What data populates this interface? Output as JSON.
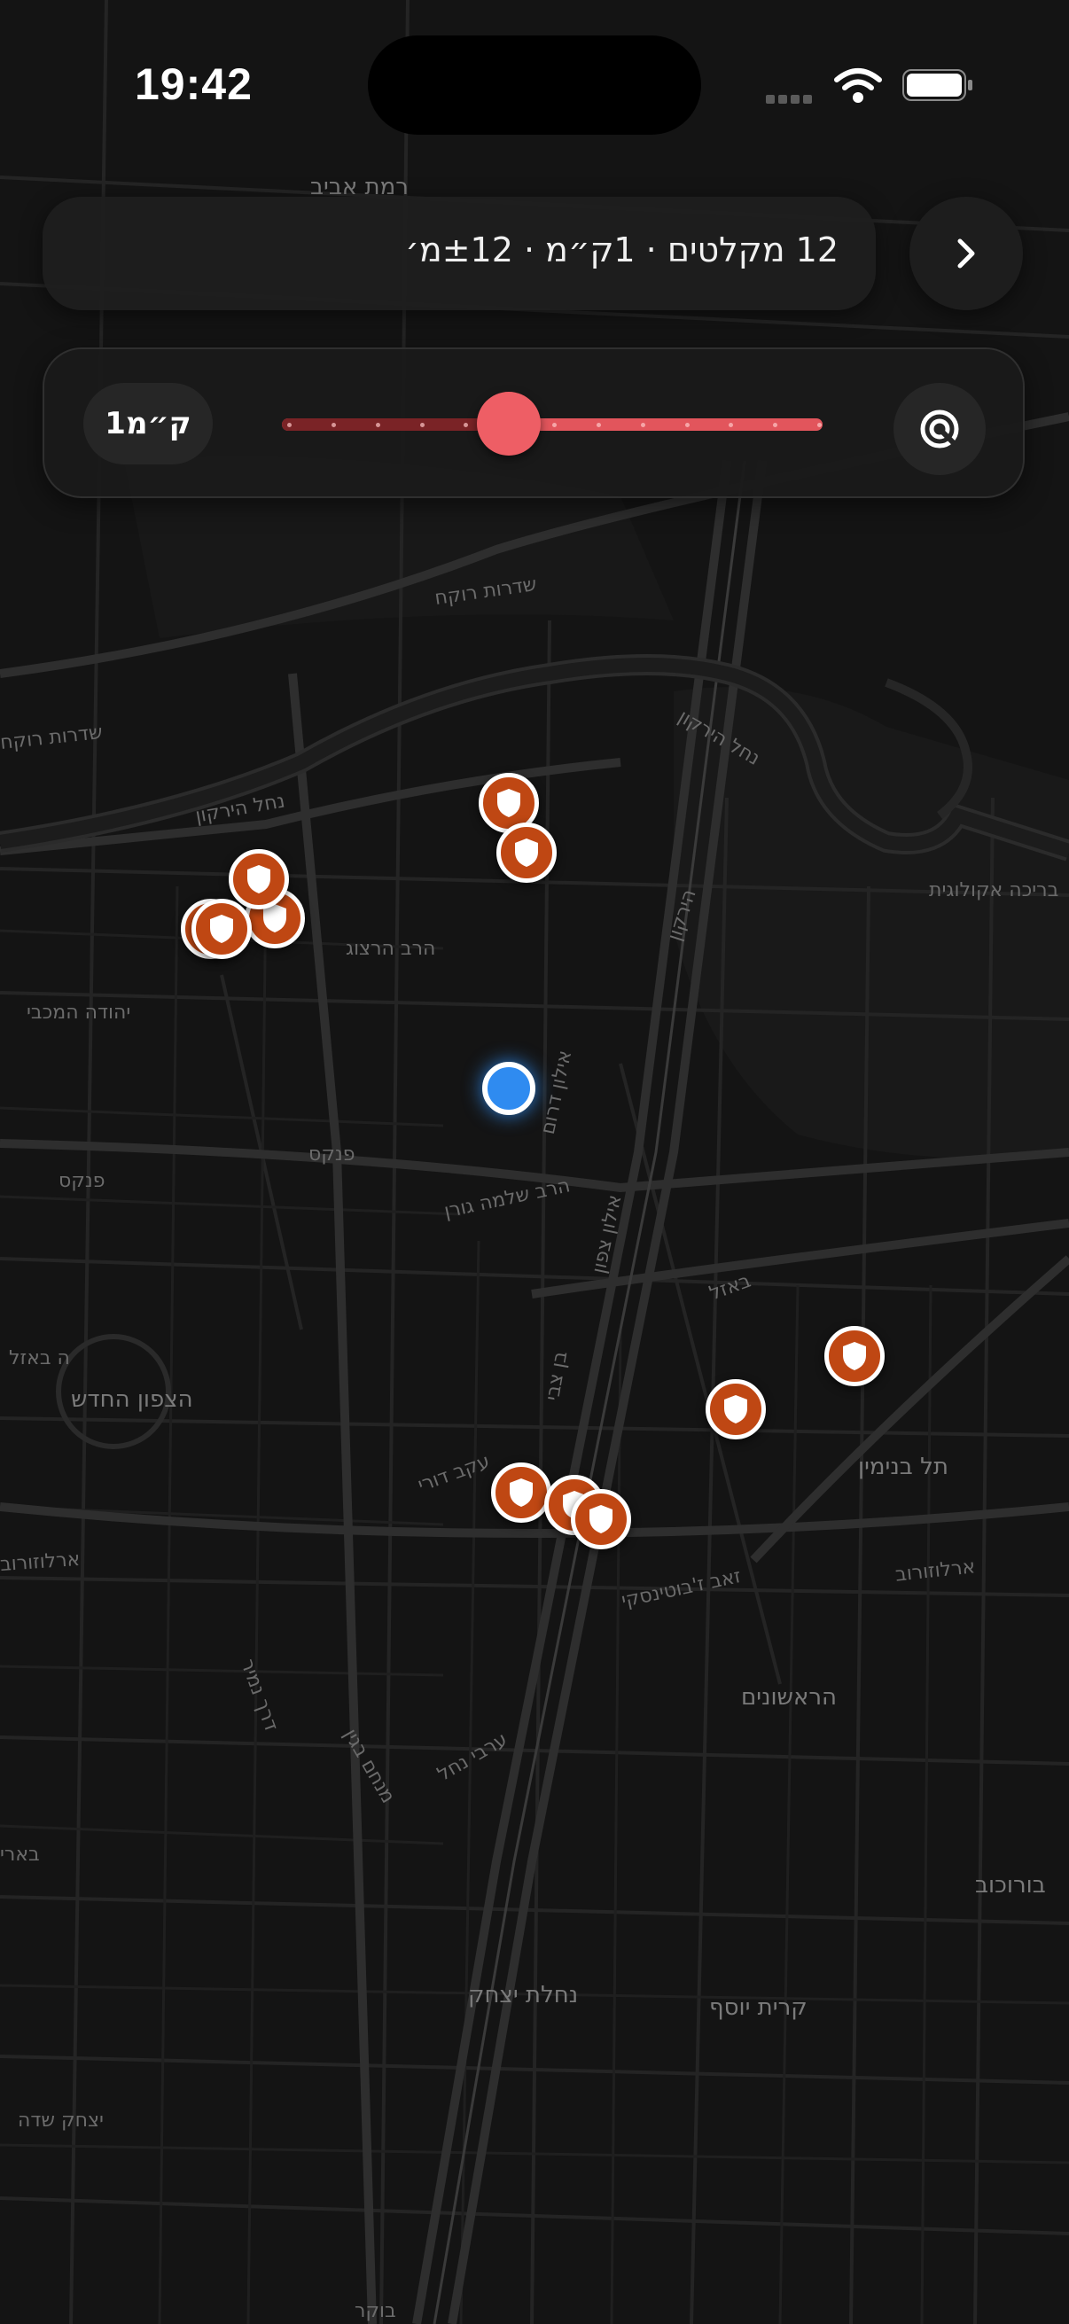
{
  "status_bar": {
    "time": "19:42"
  },
  "info_bar": {
    "summary": "12 מקלטים · 1ק״מ · ±12מ׳",
    "chevron_icon": "chevron-right-icon"
  },
  "radius_control": {
    "value_label": "1ק״מ",
    "slider_fraction": 0.42,
    "target_icon": "target-icon"
  },
  "map_labels": [
    "רמת אביב",
    "שדרות רוקח",
    "שדרות רוקח",
    "נחל הירקון",
    "נחל הירקון",
    "בריכה אקולוגית",
    "יהודה המכבי",
    "פנקס",
    "פנקס",
    "הרב הרצוג",
    "הרב שלמה גורן",
    "באזל",
    "ה באזל",
    "הצפון החדש",
    "אילון צפון",
    "אילון דרום",
    "ארלוזורוב",
    "ארלוזורוב",
    "תל בנימין",
    "זאב ז'בוטינסקי",
    "הראשונים",
    "בורוכוב",
    "נחלת יצחק",
    "קרית יוסף",
    "עקב דורי",
    "דרך נמיר",
    "מנחם בגין",
    "ערבי נחל",
    "בן צבי",
    "הירקון",
    "בארי",
    "יצחק שדה",
    "בוקר"
  ],
  "colors": {
    "marker_fill": "#bf4713",
    "accent_slider": "#ee5e65",
    "user_dot": "#2f8bf0"
  }
}
